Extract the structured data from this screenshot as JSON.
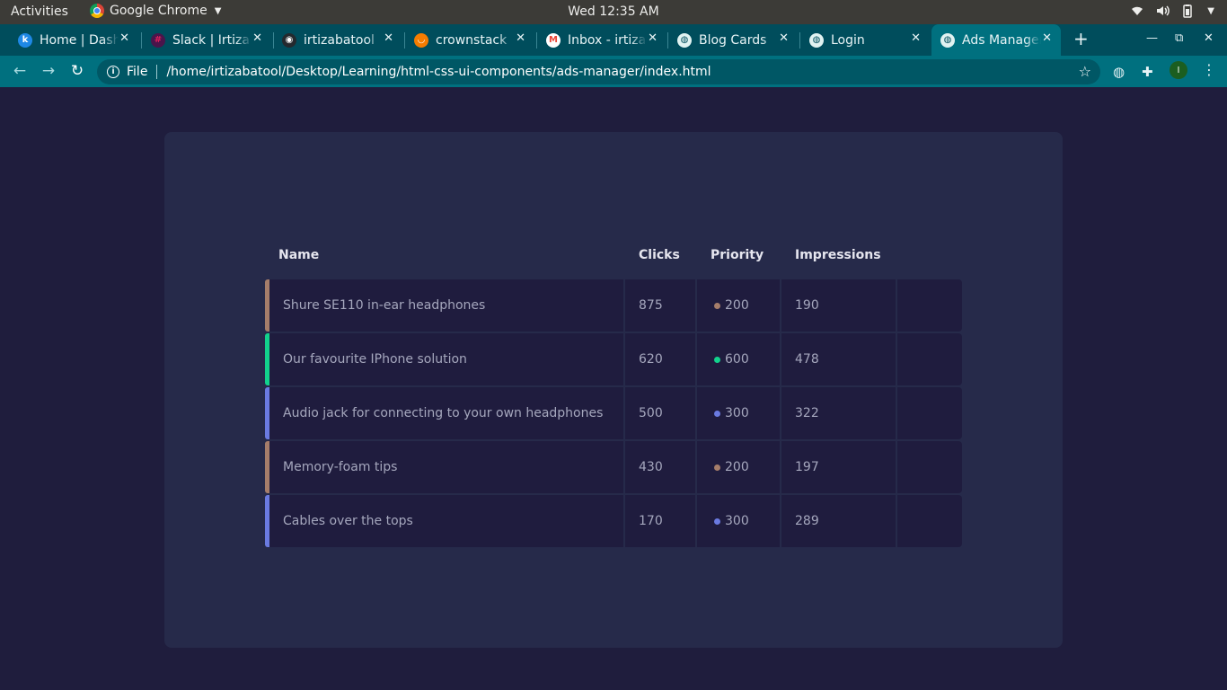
{
  "system": {
    "activities": "Activities",
    "app_name": "Google Chrome",
    "clock": "Wed 12:35 AM"
  },
  "browser": {
    "tabs": [
      {
        "label": "Home | Dash",
        "favicon": "k-icon",
        "favicon_color": "#1e88e5",
        "glyph": "k"
      },
      {
        "label": "Slack | Irtiza",
        "favicon": "slack-icon",
        "favicon_color": "#4a154b",
        "glyph": "#"
      },
      {
        "label": "irtizabatool",
        "favicon": "github-icon",
        "favicon_color": "#24292e",
        "glyph": "◉"
      },
      {
        "label": "crownstack",
        "favicon": "crownstack-icon",
        "favicon_color": "#f57c00",
        "glyph": "◡"
      },
      {
        "label": "Inbox - irtiza",
        "favicon": "gmail-icon",
        "favicon_color": "#ffffff",
        "glyph": "M"
      },
      {
        "label": "Blog Cards",
        "favicon": "globe-icon",
        "favicon_color": "#e0f2f1",
        "glyph": "◍"
      },
      {
        "label": "Login",
        "favicon": "globe-icon",
        "favicon_color": "#e0f2f1",
        "glyph": "◍"
      },
      {
        "label": "Ads Manager",
        "favicon": "globe-icon",
        "favicon_color": "#e0f2f1",
        "glyph": "◍"
      }
    ],
    "address": {
      "scheme_label": "File",
      "url": "/home/irtizabatool/Desktop/Learning/html-css-ui-components/ads-manager/index.html"
    },
    "profile_initial": "I"
  },
  "table": {
    "headers": {
      "name": "Name",
      "clicks": "Clicks",
      "priority": "Priority",
      "impressions": "Impressions"
    },
    "rows": [
      {
        "name": "Shure SE110 in-ear headphones",
        "clicks": "875",
        "priority": "200",
        "impressions": "190",
        "color": "#a57d6a"
      },
      {
        "name": "Our favourite IPhone solution",
        "clicks": "620",
        "priority": "600",
        "impressions": "478",
        "color": "#12d28c"
      },
      {
        "name": "Audio jack for connecting to your own headphones",
        "clicks": "500",
        "priority": "300",
        "impressions": "322",
        "color": "#6a7ae0"
      },
      {
        "name": "Memory-foam tips",
        "clicks": "430",
        "priority": "200",
        "impressions": "197",
        "color": "#a57d6a"
      },
      {
        "name": "Cables over the tops",
        "clicks": "170",
        "priority": "300",
        "impressions": "289",
        "color": "#6a7ae0"
      }
    ]
  }
}
